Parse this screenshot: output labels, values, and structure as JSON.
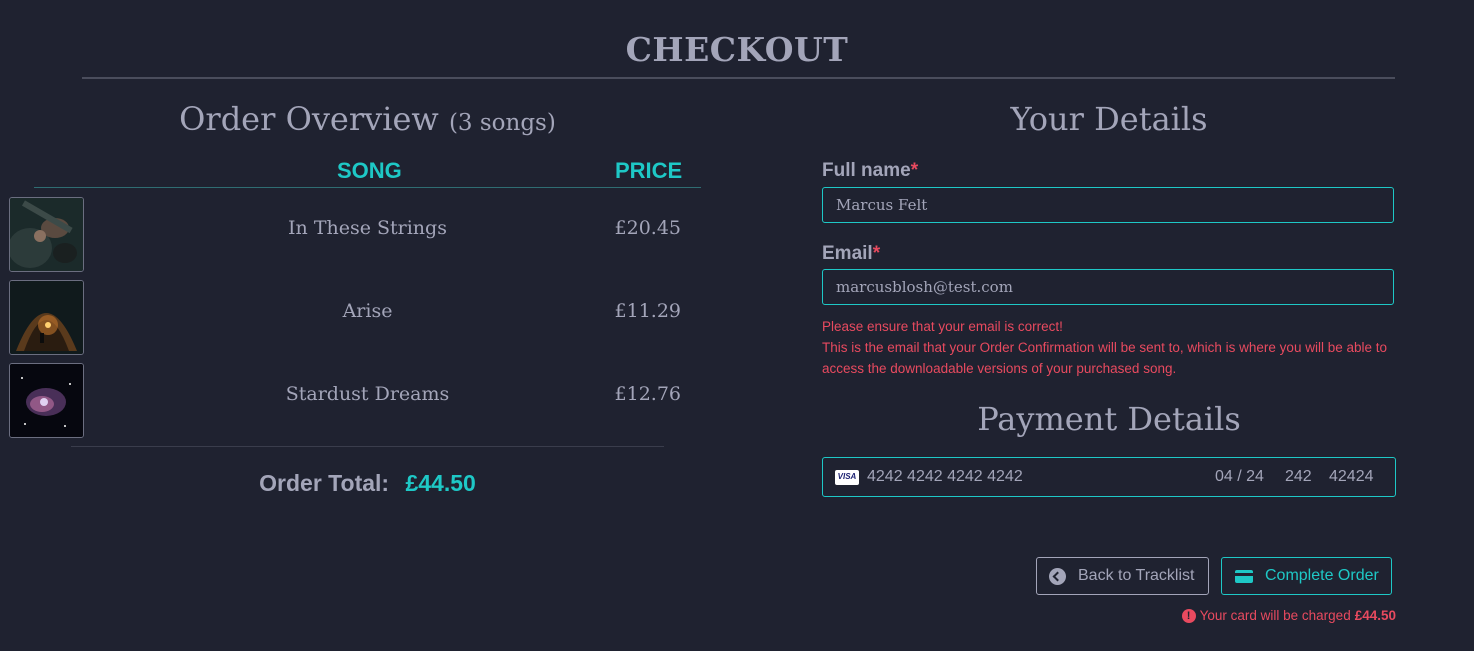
{
  "page": {
    "title": "CHECKOUT"
  },
  "order": {
    "heading": "Order Overview",
    "count_label": "(3 songs)",
    "columns": {
      "song": "SONG",
      "price": "PRICE"
    },
    "items": [
      {
        "name": "In These Strings",
        "price": "£20.45",
        "image": "guitar-player-image"
      },
      {
        "name": "Arise",
        "price": "£11.29",
        "image": "candle-cave-image"
      },
      {
        "name": "Stardust Dreams",
        "price": "£12.76",
        "image": "nebula-image"
      }
    ],
    "total_label": "Order Total:",
    "total_value": "£44.50"
  },
  "details": {
    "heading": "Your Details",
    "full_name_label": "Full name",
    "full_name_value": "Marcus Felt",
    "email_label": "Email",
    "email_value": "marcusblosh@test.com",
    "required_mark": "*",
    "email_warning_line1": "Please ensure that your email is correct!",
    "email_warning_line2": "This is the email that your Order Confirmation will be sent to, which is where you will be able to access the downloadable versions of your purchased song."
  },
  "payment": {
    "heading": "Payment Details",
    "card_brand": "VISA",
    "card_number": "4242 4242 4242 4242",
    "expiry": "04 / 24",
    "cvc": "242",
    "postal": "42424"
  },
  "actions": {
    "back_label": "Back to Tracklist",
    "complete_label": "Complete Order",
    "charge_note": "Your card will be charged",
    "charge_amount": "£44.50"
  },
  "colors": {
    "background": "#1f2230",
    "text": "#a3a5b9",
    "accent": "#1ec8c6",
    "error": "#e84a5f"
  }
}
